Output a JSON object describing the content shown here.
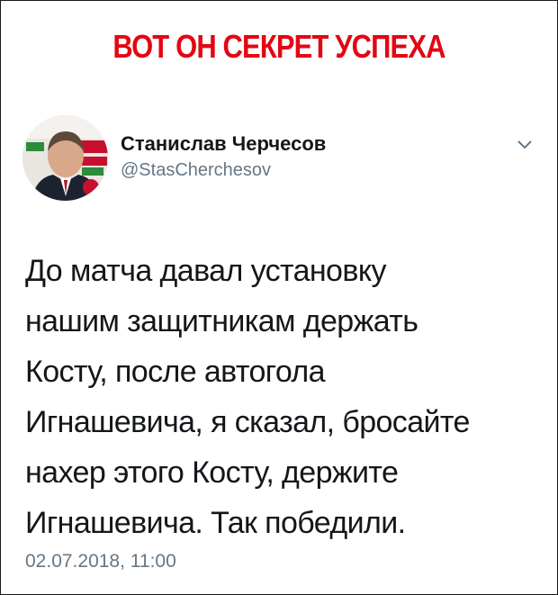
{
  "headline": "ВОТ ОН СЕКРЕТ УСПЕХА",
  "tweet": {
    "author": {
      "name": "Станислав Черчесов",
      "handle": "@StasCherchesov"
    },
    "text_lines": [
      "До матча давал установку",
      "нашим защитникам держать",
      "Косту, после автогола",
      "Игнашевича, я сказал, бросайте",
      "нахер этого Косту, держите",
      "Игнашевича. Так победили."
    ],
    "timestamp": "02.07.2018, 11:00"
  },
  "icons": {
    "menu": "chevron-down-icon"
  },
  "colors": {
    "headline": "#e30613",
    "text": "#14171a",
    "secondary": "#657786"
  }
}
